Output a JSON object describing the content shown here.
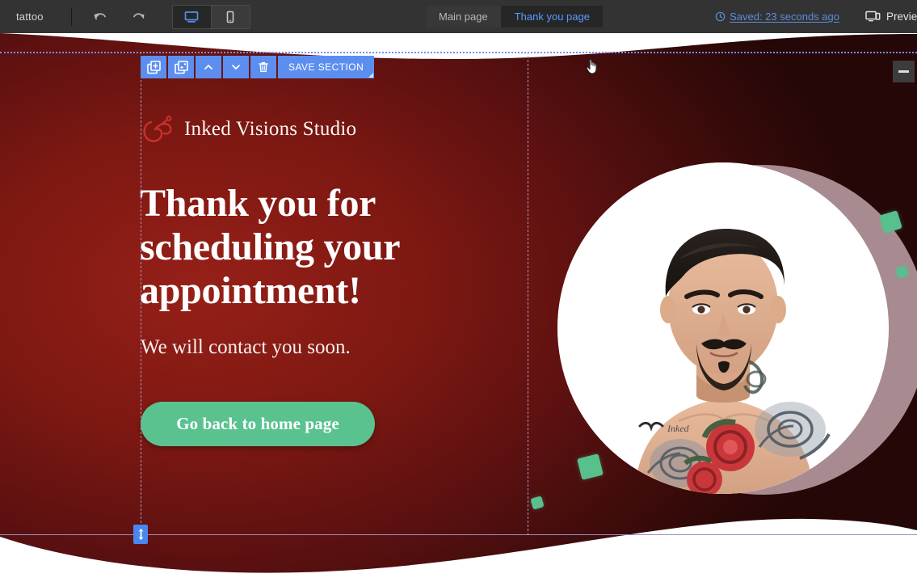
{
  "topbar": {
    "project_name": "tattoo",
    "undo_icon": "undo-arrow-icon",
    "redo_icon": "redo-arrow-icon",
    "desktop_view_icon": "desktop-monitor-icon",
    "mobile_view_icon": "mobile-phone-icon",
    "active_view": "desktop",
    "saved_status": "Saved: 23 seconds ago",
    "saved_icon": "clock-icon",
    "preview_label": "Preview",
    "preview_icon": "preview-monitor-icon",
    "tabs": [
      {
        "label": "Main page",
        "active": false
      },
      {
        "label": "Thank you page",
        "active": true
      }
    ]
  },
  "section_toolbar": {
    "add_block_icon": "add-block-icon",
    "duplicate_icon": "duplicate-section-icon",
    "move_up_icon": "chevron-up-icon",
    "move_down_icon": "chevron-down-icon",
    "delete_icon": "trash-icon",
    "save_section_label": "SAVE SECTION"
  },
  "canvas_controls": {
    "collapse_icon": "minus-collapse-icon",
    "resize_icon": "vertical-resize-arrows-icon"
  },
  "page": {
    "logo": {
      "icon": "tattoo-machine-outline-icon",
      "text": "Inked Visions Studio"
    },
    "headline": "Thank you for scheduling your appointment!",
    "subtext": "We will contact you soon.",
    "cta_label": "Go back to home page",
    "photo_alt": "portrait-of-tattooed-man",
    "decor": {
      "shadow_circle": "mauve-shadow-circle",
      "green_squares": 4
    }
  },
  "colors": {
    "toolbar_bg": "#333333",
    "editor_blue": "#5c8ef0",
    "tab_active_text": "#5b9bff",
    "saved_link": "#5b8ddb",
    "hero_red_light": "#962018",
    "hero_red_dark": "#260707",
    "accent_green": "#5ac28f",
    "shadow_circle": "#a88b90",
    "guide_line": "#a095c9"
  }
}
